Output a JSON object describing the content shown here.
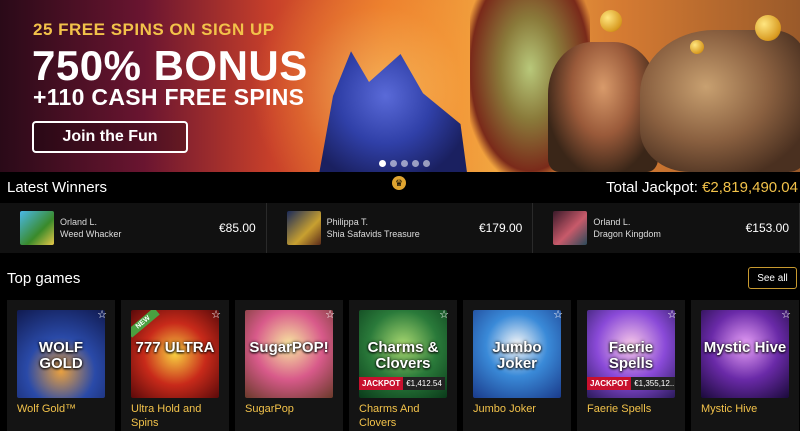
{
  "banner": {
    "top_line": "25 FREE SPINS ON SIGN UP",
    "headline": "750% BONUS",
    "subline": "+110 CASH FREE SPINS",
    "cta_label": "Join the Fun",
    "carousel_dots": 5,
    "active_dot": 0
  },
  "winners": {
    "title": "Latest Winners",
    "jackpot_label": "Total Jackpot:",
    "jackpot_value": "€2,819,490.04",
    "items": [
      {
        "player": "Orland L.",
        "game": "Weed Whacker",
        "amount": "€85.00"
      },
      {
        "player": "Philippa T.",
        "game": "Shia Safavids Treasure",
        "amount": "€179.00"
      },
      {
        "player": "Orland L.",
        "game": "Dragon Kingdom",
        "amount": "€153.00"
      }
    ]
  },
  "top_games": {
    "title": "Top games",
    "see_all": "See all",
    "games": [
      {
        "name": "Wolf Gold™",
        "art_text": "WOLF GOLD",
        "art_color": "#2a4aa8"
      },
      {
        "name": "Ultra Hold and Spins",
        "art_text": "777 ULTRA",
        "badge": "NEW",
        "art_color": "#c82a1a"
      },
      {
        "name": "SugarPop",
        "art_text": "SugarPOP!",
        "art_color": "#d85a8a"
      },
      {
        "name": "Charms And Clovers",
        "art_text": "Charms & Clovers",
        "jackpot_label": "JACKPOT",
        "jackpot_value": "€1,412.54",
        "art_color": "#2a7a3a"
      },
      {
        "name": "Jumbo Joker",
        "art_text": "Jumbo Joker",
        "art_color": "#3a8ad8"
      },
      {
        "name": "Faerie Spells",
        "art_text": "Faerie Spells",
        "jackpot_label": "JACKPOT",
        "jackpot_value": "€1,355,12...",
        "art_color": "#8a4ad8"
      },
      {
        "name": "Mystic Hive",
        "art_text": "Mystic Hive",
        "art_color": "#6a2aa8"
      }
    ]
  }
}
